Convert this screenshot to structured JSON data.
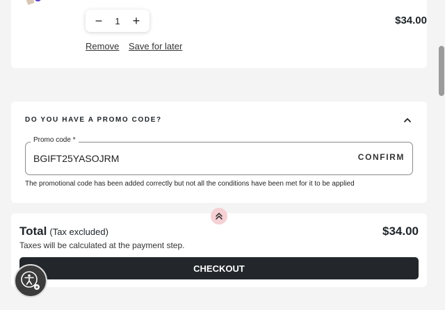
{
  "cart_item": {
    "quantity": "1",
    "minus_symbol": "−",
    "plus_symbol": "+",
    "price": "$34.00",
    "remove_label": "Remove",
    "save_for_later_label": "Save for later"
  },
  "promo": {
    "heading": "DO YOU HAVE A PROMO CODE?",
    "field_label": "Promo code *",
    "code_value": "BGIFT25YASOJRM",
    "confirm_label": "CONFIRM",
    "message": "The promotional code has been added correctly but not all the conditions have been met for it to be applied",
    "chevron_icon": "chevron-up-icon"
  },
  "summary": {
    "total_label": "Total",
    "total_sub": "(Tax excluded)",
    "total_value": "$34.00",
    "tax_note": "Taxes will be calculated at the payment step.",
    "checkout_label": "CHECKOUT"
  },
  "icons": {
    "scroll_to_top": "double-chevron-up-icon",
    "accessibility": "accessibility-icon"
  },
  "colors": {
    "checkout_bg": "#23272b",
    "scroll_top_bg": "#f5d0d4",
    "page_bg": "#f4f4f4"
  }
}
